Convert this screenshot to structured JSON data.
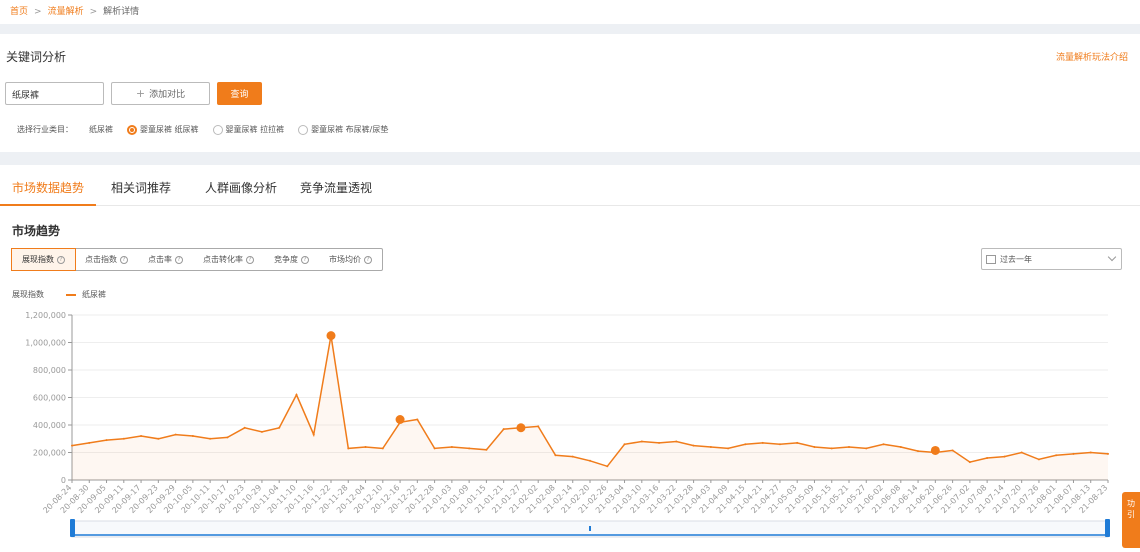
{
  "breadcrumb": {
    "home": "首页",
    "traffic": "流量解析",
    "current": "解析详情",
    "sep": ">"
  },
  "keyword_analysis": {
    "title": "关键词分析",
    "intro_link": "流量解析玩法介绍",
    "keyword_value": "纸尿裤",
    "add_compare": "添加对比",
    "query_button": "查询",
    "category_label": "选择行业类目：",
    "category_plain": "纸尿裤",
    "radios": [
      {
        "label": "婴童尿裤 纸尿裤",
        "checked": true
      },
      {
        "label": "婴童尿裤 拉拉裤",
        "checked": false
      },
      {
        "label": "婴童尿裤 布尿裤/尿垫",
        "checked": false
      }
    ]
  },
  "tabs": [
    "市场数据趋势",
    "相关词推荐",
    "人群画像分析",
    "竞争流量透视"
  ],
  "market_trend": {
    "title": "市场趋势",
    "metrics": [
      "展现指数",
      "点击指数",
      "点击率",
      "点击转化率",
      "竞争度",
      "市场均价"
    ],
    "date_range": "过去一年"
  },
  "side_button": {
    "line1": "功",
    "line2": "引"
  },
  "colors": {
    "accent": "#f07c1b"
  },
  "icons": [
    "plus-icon",
    "help-circle-icon",
    "calendar-icon",
    "chevron-down-icon",
    "radio-icon"
  ],
  "chart_data": {
    "type": "area",
    "ylabel": "展现指数",
    "ylim": [
      0,
      1200000
    ],
    "yticks": [
      0,
      200000,
      400000,
      600000,
      800000,
      1000000,
      1200000
    ],
    "ytick_labels": [
      "0",
      "200,000",
      "400,000",
      "600,000",
      "800,000",
      "1,000,000",
      "1,200,000"
    ],
    "grid": true,
    "legend_position": "top-left",
    "x_tick_labels": [
      "20-08-24",
      "20-08-30",
      "20-09-05",
      "20-09-11",
      "20-09-17",
      "20-09-23",
      "20-09-29",
      "20-10-05",
      "20-10-11",
      "20-10-17",
      "20-10-23",
      "20-10-29",
      "20-11-04",
      "20-11-10",
      "20-11-16",
      "20-11-22",
      "20-11-28",
      "20-12-04",
      "20-12-10",
      "20-12-16",
      "20-12-22",
      "20-12-28",
      "21-01-03",
      "21-01-09",
      "21-01-15",
      "21-01-21",
      "21-01-27",
      "21-02-02",
      "21-02-08",
      "21-02-14",
      "21-02-20",
      "21-02-26",
      "21-03-04",
      "21-03-10",
      "21-03-16",
      "21-03-22",
      "21-03-28",
      "21-04-03",
      "21-04-09",
      "21-04-15",
      "21-04-21",
      "21-04-27",
      "21-05-03",
      "21-05-09",
      "21-05-15",
      "21-05-21",
      "21-05-27",
      "21-06-02",
      "21-06-08",
      "21-06-14",
      "21-06-20",
      "21-06-26",
      "21-07-02",
      "21-07-08",
      "21-07-14",
      "21-07-20",
      "21-07-26",
      "21-08-01",
      "21-08-07",
      "21-08-13",
      "21-08-23"
    ],
    "series": [
      {
        "name": "纸尿裤",
        "values": [
          250000,
          270000,
          290000,
          300000,
          320000,
          300000,
          330000,
          320000,
          300000,
          310000,
          380000,
          350000,
          380000,
          620000,
          330000,
          1050000,
          230000,
          240000,
          230000,
          420000,
          440000,
          230000,
          240000,
          230000,
          220000,
          370000,
          380000,
          390000,
          180000,
          170000,
          140000,
          100000,
          260000,
          280000,
          270000,
          280000,
          250000,
          240000,
          230000,
          260000,
          270000,
          260000,
          270000,
          240000,
          230000,
          240000,
          230000,
          260000,
          240000,
          210000,
          200000,
          215000,
          130000,
          160000,
          170000,
          200000,
          150000,
          180000,
          190000,
          200000,
          190000
        ],
        "highlights": [
          {
            "index": 15,
            "value": 1050000
          },
          {
            "index": 19,
            "value": 440000
          },
          {
            "index": 26,
            "value": 380000
          },
          {
            "index": 50,
            "value": 215000
          }
        ]
      }
    ]
  }
}
